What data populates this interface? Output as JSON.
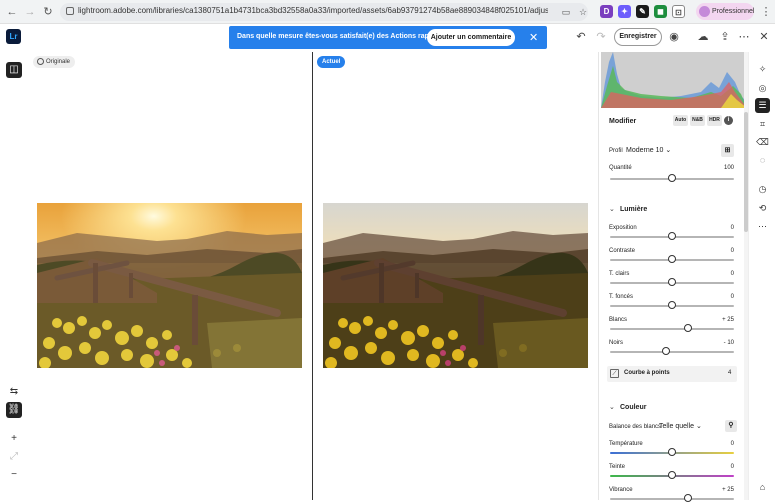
{
  "browser": {
    "url": "lightroom.adobe.com/libraries/ca1380751a1b4731bca3bd32558a0a33/imported/assets/6ab93791274b58ae889034848f025101/adjust?panel=organize...",
    "profile_label": "Professionnel",
    "extensions": [
      "D",
      "✦",
      "✎",
      "◼",
      "⊡"
    ],
    "menu_icon": "⋮"
  },
  "header": {
    "logo": "Lr",
    "banner_text": "Dans quelle mesure êtes-vous satisfait(e) des Actions rapides ?",
    "banner_button": "Ajouter un commentaire",
    "banner_close": "✕",
    "save_label": "Enregistrer"
  },
  "canvas": {
    "original_tag": "Originale",
    "actual_tag": "Actuel"
  },
  "panel": {
    "title": "Modifier",
    "buttons": [
      "Auto",
      "N&B",
      "HDR"
    ],
    "profile_label": "Profil",
    "profile_value": "Moderne 10",
    "quantity_label": "Quantité",
    "quantity_value": "100",
    "quantity_level": 1.0,
    "light_section": "Lumière",
    "light_sliders": [
      {
        "label": "Exposition",
        "value": "0",
        "level": 0.5
      },
      {
        "label": "Contraste",
        "value": "0",
        "level": 0.5
      },
      {
        "label": "T. clairs",
        "value": "0",
        "level": 0.5
      },
      {
        "label": "T. foncés",
        "value": "0",
        "level": 0.5
      },
      {
        "label": "Blancs",
        "value": "+ 25",
        "level": 0.625
      },
      {
        "label": "Noirs",
        "value": "- 10",
        "level": 0.45
      }
    ],
    "curve_label": "Courbe à points",
    "curve_count": "4",
    "color_section": "Couleur",
    "wb_label": "Balance des blancs",
    "wb_value": "Telle quelle",
    "color_sliders": [
      {
        "label": "Température",
        "value": "0",
        "level": 0.5
      },
      {
        "label": "Teinte",
        "value": "0",
        "level": 0.5
      },
      {
        "label": "Vibrance",
        "value": "+ 25",
        "level": 0.625
      }
    ]
  },
  "colors": {
    "accent": "#2680eb",
    "logo_bg": "#0a1b3a",
    "logo_text": "#31a8ff"
  }
}
